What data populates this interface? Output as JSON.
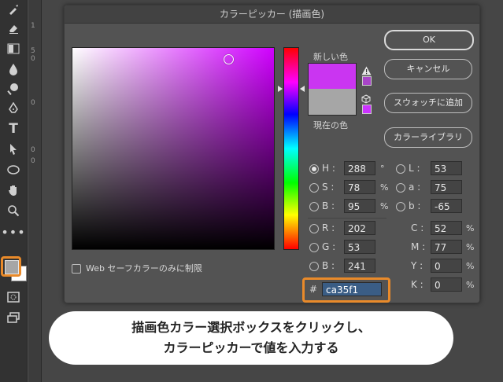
{
  "dialog": {
    "title": "カラーピッカー (描画色)"
  },
  "swatches": {
    "new_label": "新しい色",
    "current_label": "現在の色",
    "new_color": "#ca35f1",
    "current_color": "#a6a6a6"
  },
  "buttons": {
    "ok": "OK",
    "cancel": "キャンセル",
    "add_swatch": "スウォッチに追加",
    "library": "カラーライブラリ"
  },
  "hsb": [
    {
      "label": "H :",
      "value": "288",
      "unit": "°",
      "selected": true
    },
    {
      "label": "S :",
      "value": "78",
      "unit": "%",
      "selected": false
    },
    {
      "label": "B :",
      "value": "95",
      "unit": "%",
      "selected": false
    }
  ],
  "lab": [
    {
      "label": "L :",
      "value": "53"
    },
    {
      "label": "a :",
      "value": "75"
    },
    {
      "label": "b :",
      "value": "-65"
    }
  ],
  "rgb": [
    {
      "label": "R :",
      "value": "202"
    },
    {
      "label": "G :",
      "value": "53"
    },
    {
      "label": "B :",
      "value": "241"
    }
  ],
  "cmyk": [
    {
      "label": "C :",
      "value": "52",
      "unit": "%"
    },
    {
      "label": "M :",
      "value": "77",
      "unit": "%"
    },
    {
      "label": "Y :",
      "value": "0",
      "unit": "%"
    },
    {
      "label": "K :",
      "value": "0",
      "unit": "%"
    }
  ],
  "hex": {
    "prefix": "#",
    "value": "ca35f1"
  },
  "web_only": {
    "label": "Web セーフカラーのみに制限",
    "checked": false
  },
  "ruler": {
    "marks": [
      "1",
      "5",
      "0",
      "0",
      "0",
      "0"
    ]
  },
  "callout": {
    "line1": "描画色カラー選択ボックスをクリックし、",
    "line2": "カラーピッカーで値を入力する"
  },
  "colors": {
    "accent_orange": "#e98a2a",
    "hex_highlight": "#3a5d85"
  }
}
